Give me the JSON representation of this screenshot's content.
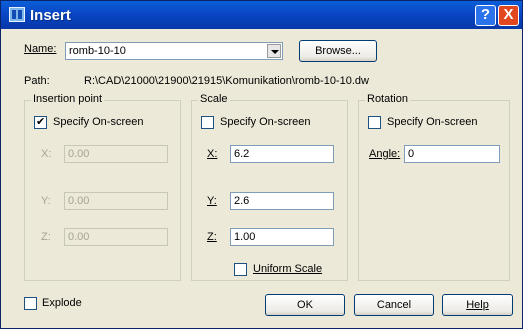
{
  "window": {
    "title": "Insert",
    "help": "?",
    "close": "X"
  },
  "name": {
    "label": "Name:",
    "value": "romb-10-10",
    "browse": "Browse..."
  },
  "path": {
    "label": "Path:",
    "value": "R:\\CAD\\21000\\21900\\21915\\Komunikation\\romb-10-10.dw"
  },
  "insertion": {
    "title": "Insertion point",
    "specify": "Specify On-screen",
    "x_label": "X:",
    "x": "0.00",
    "y_label": "Y:",
    "y": "0.00",
    "z_label": "Z:",
    "z": "0.00"
  },
  "scale": {
    "title": "Scale",
    "specify": "Specify On-screen",
    "x_label": "X:",
    "x": "6.2",
    "y_label": "Y:",
    "y": "2.6",
    "z_label": "Z:",
    "z": "1.00",
    "uniform": "Uniform Scale"
  },
  "rotation": {
    "title": "Rotation",
    "specify": "Specify On-screen",
    "angle_label": "Angle:",
    "angle": "0"
  },
  "explode": "Explode",
  "buttons": {
    "ok": "OK",
    "cancel": "Cancel",
    "help": "Help"
  }
}
